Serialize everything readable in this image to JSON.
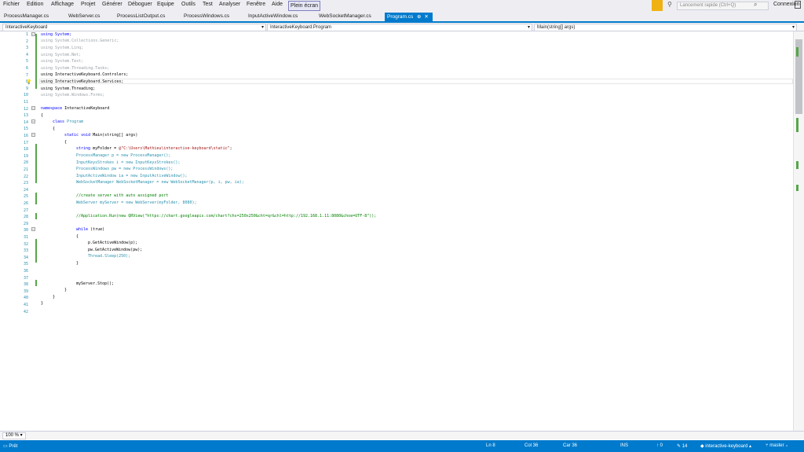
{
  "menu": {
    "items": [
      "Fichier",
      "Edition",
      "Affichage",
      "Projet",
      "Générer",
      "Déboguer",
      "Equipe",
      "Outils",
      "Test",
      "Analyser",
      "Fenêtre",
      "Aide"
    ],
    "fullscreen": "Plein écran",
    "quicklaunch_placeholder": "Lancement rapide (Ctrl+Q)",
    "connexion": "Connexion"
  },
  "tabs": {
    "items": [
      "ProcessManager.cs",
      "WebServer.cs",
      "ProcessListOutput.cs",
      "ProcessWindows.cs",
      "InputActiveWindow.cs",
      "WebSocketManager.cs"
    ],
    "active": "Program.cs"
  },
  "navbar": {
    "project": "InteractiveKeyboard",
    "class": "InteractiveKeyboard.Program",
    "member": "Main(string[] args)"
  },
  "editor": {
    "line_numbers": [
      "1",
      "2",
      "3",
      "4",
      "5",
      "6",
      "7",
      "8",
      "9",
      "10",
      "11",
      "12",
      "13",
      "14",
      "15",
      "16",
      "17",
      "18",
      "19",
      "20",
      "21",
      "22",
      "23",
      "24",
      "25",
      "26",
      "27",
      "28",
      "29",
      "30",
      "31",
      "32",
      "33",
      "34",
      "35",
      "36",
      "37",
      "38",
      "39",
      "40",
      "41",
      "42"
    ],
    "lines": {
      "l1": "using System;",
      "l2": "using System.Collections.Generic;",
      "l3": "using System.Linq;",
      "l4": "using System.Net;",
      "l5": "using System.Text;",
      "l6": "using System.Threading.Tasks;",
      "l7": "using InteractiveKeyboard.Controlers;",
      "l8": "using InteractiveKeyboard.Services;",
      "l9": "using System.Threading;",
      "l10": "using System.Windows.Forms;",
      "l12a": "namespace",
      "l12b": " InteractiveKeyboard",
      "l13": "{",
      "l14a": "class",
      "l14b": " Program",
      "l15": "{",
      "l16a": "static void",
      "l16b": " Main(string[] args)",
      "l17": "{",
      "l18a": "string",
      "l18b": " myFolder = ",
      "l18c": "@\"C:\\Users\\Mathieu\\interactive-keyboard\\static\"",
      "l18d": ";",
      "l19": "ProcessManager p = new ProcessManager();",
      "l20": "InputKeysStrokes i = new InputKeysStrokes();",
      "l21": "ProcessWindows pw = new ProcessWindows();",
      "l22": "InputActiveWindow ia = new InputActiveWindow();",
      "l23": "WebSocketManager WebSocketManager = new WebSocketManager(p, i, pw, ia);",
      "l25": "//create server with auto assigned port",
      "l26": "WebServer myServer = new WebServer(myFolder, 8080);",
      "l28": "//Application.Run(new QRView(\"https://chart.googleapis.com/chart?chs=250x250&cht=qr&chl=http://192.168.1.11:8080&choe=UTF-8\"));",
      "l30a": "while",
      "l30b": " (true)",
      "l31": "{",
      "l32": "p.GetActiveWindow(p);",
      "l33": "pw.GetActiveWindow(pw);",
      "l34": "Thread.Sleep(250);",
      "l35": "}",
      "l38": "myServer.Stop();",
      "l39": "}",
      "l40": "}",
      "l41": "}"
    }
  },
  "zoom": "100 %",
  "status": {
    "ready": "Prêt",
    "ln": "Ln 8",
    "col": "Col 36",
    "car": "Car 36",
    "ins": "INS",
    "up": "0",
    "edits": "14",
    "repo": "interactive-keyboard",
    "branch": "master"
  },
  "colors": {
    "accent": "#007acc",
    "keyword": "#0000ff",
    "type": "#2b91af",
    "string": "#a31515",
    "comment": "#008000",
    "change_marker": "#57a64a"
  }
}
